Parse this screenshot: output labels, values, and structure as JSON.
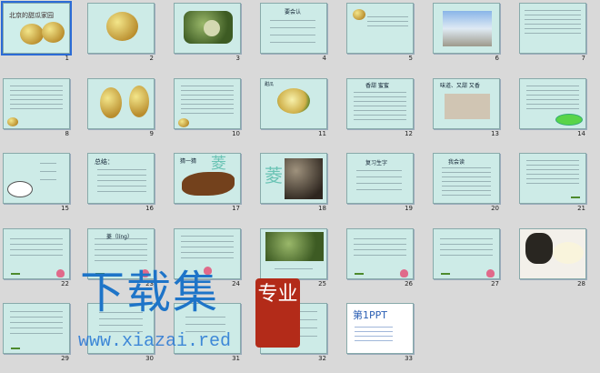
{
  "slides": [
    {
      "n": "1",
      "title": "北京的甜瓜家园"
    },
    {
      "n": "2"
    },
    {
      "n": "3"
    },
    {
      "n": "4"
    },
    {
      "n": "5"
    },
    {
      "n": "6"
    },
    {
      "n": "7"
    },
    {
      "n": "8"
    },
    {
      "n": "9"
    },
    {
      "n": "10"
    },
    {
      "n": "11"
    },
    {
      "n": "12"
    },
    {
      "n": "13"
    },
    {
      "n": "14"
    },
    {
      "n": "15"
    },
    {
      "n": "16"
    },
    {
      "n": "17"
    },
    {
      "n": "18"
    },
    {
      "n": "19"
    },
    {
      "n": "20"
    },
    {
      "n": "21"
    },
    {
      "n": "22"
    },
    {
      "n": "23"
    },
    {
      "n": "24"
    },
    {
      "n": "25"
    },
    {
      "n": "26"
    },
    {
      "n": "27"
    },
    {
      "n": "28"
    },
    {
      "n": "29"
    },
    {
      "n": "30"
    },
    {
      "n": "31"
    },
    {
      "n": "32"
    },
    {
      "n": "33"
    }
  ],
  "slide_texts": {
    "s4_title": "要会认",
    "s12_title": "香甜 蜜蜜",
    "s13_title": "味道、又甜 又香",
    "s16_title": "总结：",
    "s17_title": "猜一猜",
    "s17_char": "菱",
    "s18_char": "菱",
    "s19_title": "复习生字",
    "s20_title": "我会读",
    "s23_title": "菱（líng）",
    "s33_logo": "第1PPT"
  },
  "watermark": {
    "main": "下载集",
    "seal": "专业",
    "url": "www.xiazai.red"
  }
}
